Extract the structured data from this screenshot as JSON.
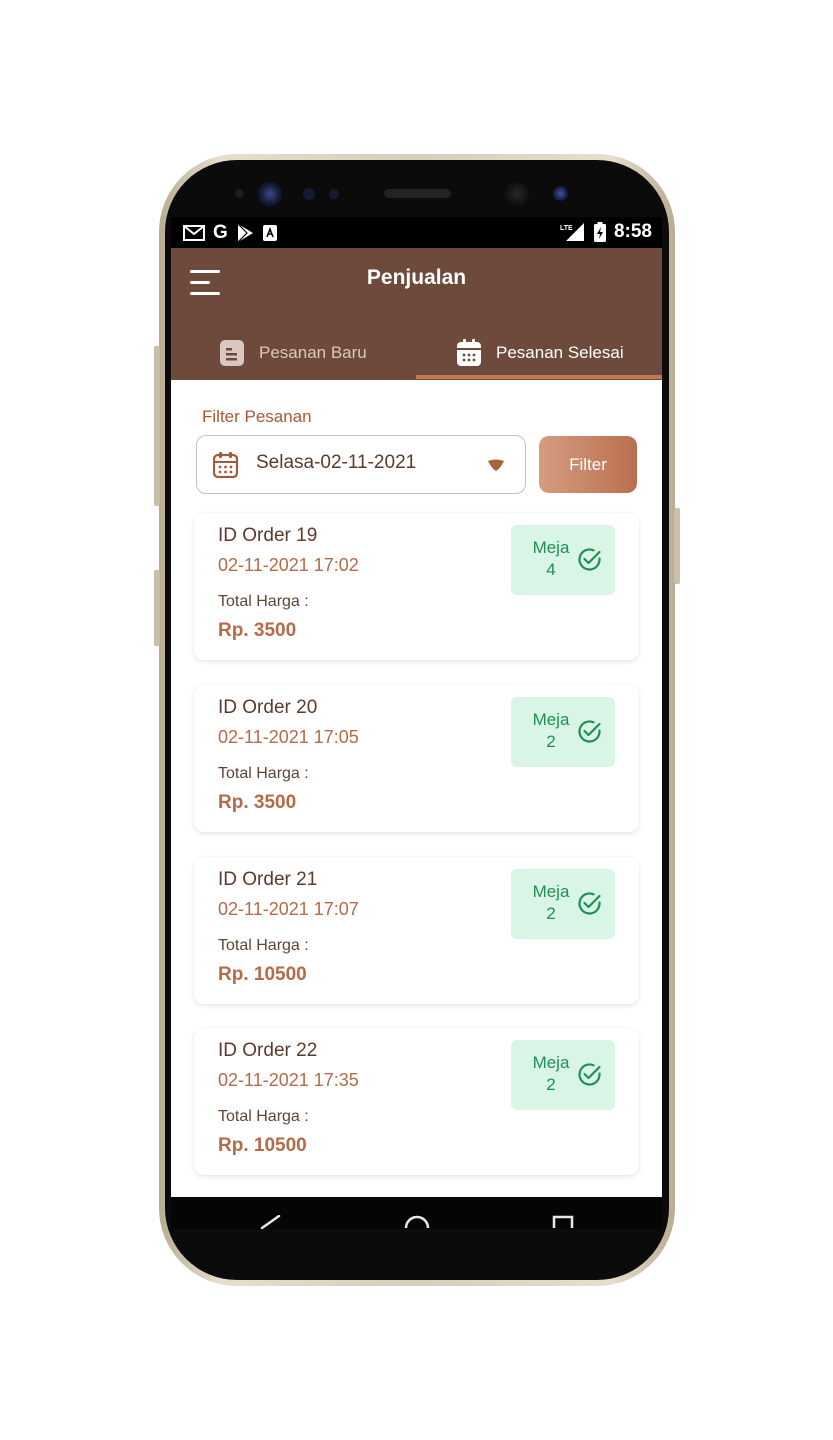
{
  "status_bar": {
    "left_icons": [
      "gmail-icon",
      "google-icon",
      "play-store-icon",
      "app-notification-icon"
    ],
    "network_label": "LTE",
    "time": "8:58"
  },
  "app_bar": {
    "title": "Penjualan"
  },
  "tabs": [
    {
      "label": "Pesanan Baru",
      "icon": "document-icon",
      "active": false
    },
    {
      "label": "Pesanan Selesai",
      "icon": "calendar-icon",
      "active": true
    }
  ],
  "filter": {
    "label": "Filter Pesanan",
    "selected_date": "Selasa-02-11-2021",
    "button_label": "Filter"
  },
  "orders": [
    {
      "id_label": "ID Order 19",
      "datetime": "02-11-2021 17:02",
      "total_label": "Total Harga :",
      "total": "Rp. 3500",
      "meja_label": "Meja",
      "meja_number": "4"
    },
    {
      "id_label": "ID Order 20",
      "datetime": "02-11-2021 17:05",
      "total_label": "Total Harga :",
      "total": "Rp. 3500",
      "meja_label": "Meja",
      "meja_number": "2"
    },
    {
      "id_label": "ID Order 21",
      "datetime": "02-11-2021 17:07",
      "total_label": "Total Harga :",
      "total": "Rp. 10500",
      "meja_label": "Meja",
      "meja_number": "2"
    },
    {
      "id_label": "ID Order 22",
      "datetime": "02-11-2021 17:35",
      "total_label": "Total Harga :",
      "total": "Rp. 10500",
      "meja_label": "Meja",
      "meja_number": "2"
    }
  ],
  "colors": {
    "appbar": "#6e4a3c",
    "accent": "#b56a48",
    "badge_bg": "#d9f5e6",
    "badge_text": "#1f9052"
  }
}
